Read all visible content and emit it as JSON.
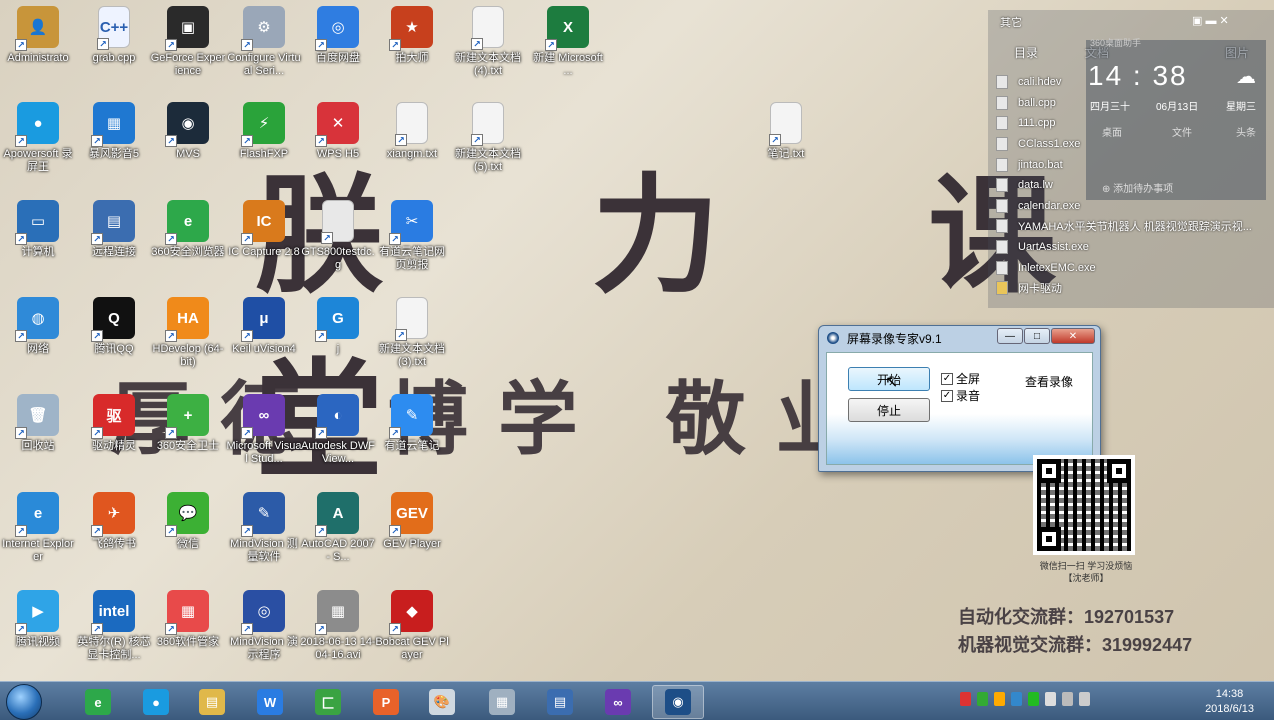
{
  "wallpaper": {
    "title": "朕 力 课 堂",
    "slogan": "厚德 博学 敬业 群",
    "group1": "自动化交流群：192701537",
    "group2": "机器视觉交流群：319992447",
    "qr_caption": "微信扫一扫 学习没烦恼\n【沈老师】"
  },
  "desktop": {
    "icons": [
      {
        "label": "Administrato",
        "color": "#c8953a",
        "glyph": "👤"
      },
      {
        "label": "grab.cpp",
        "color": "#eef3ff",
        "glyph": "C++"
      },
      {
        "label": "GeForce Experience",
        "color": "#2a2a2a",
        "glyph": "▣"
      },
      {
        "label": "Configure Virtual Seri...",
        "color": "#9aa7b8",
        "glyph": "⚙"
      },
      {
        "label": "百度网盘",
        "color": "#2f7de1",
        "glyph": "◎"
      },
      {
        "label": "拍大师",
        "color": "#c7401d",
        "glyph": "★"
      },
      {
        "label": "新建文本文档 (4).txt",
        "color": "#f4f4f4",
        "glyph": ""
      },
      {
        "label": "新建 Microsoft ...",
        "color": "#1d7c3f",
        "glyph": "X"
      },
      {
        "label": "Apowersoft 录屏王",
        "color": "#1a9be0",
        "glyph": "●"
      },
      {
        "label": "暴风影音5",
        "color": "#1f78d1",
        "glyph": "▦"
      },
      {
        "label": "MVS",
        "color": "#1c2b3a",
        "glyph": "◉"
      },
      {
        "label": "FlashFXP",
        "color": "#2aa33a",
        "glyph": "⚡"
      },
      {
        "label": "WPS H5",
        "color": "#d8333a",
        "glyph": "✕"
      },
      {
        "label": "xiangm.txt",
        "color": "#f4f4f4",
        "glyph": ""
      },
      {
        "label": "新建文本文档 (5).txt",
        "color": "#f4f4f4",
        "glyph": ""
      },
      {
        "label": "笔记.txt",
        "color": "#f4f4f4",
        "glyph": ""
      },
      {
        "label": "计算机",
        "color": "#2a6fb8",
        "glyph": "▭"
      },
      {
        "label": "远程连接",
        "color": "#3b6db0",
        "glyph": "▤"
      },
      {
        "label": "360安全浏览器",
        "color": "#2da84a",
        "glyph": "e"
      },
      {
        "label": "IC Capture 2.8",
        "color": "#d97a1c",
        "glyph": "IC"
      },
      {
        "label": "GTS800testdc.g",
        "color": "#e8e8e8",
        "glyph": ""
      },
      {
        "label": "有道云笔记网页剪报",
        "color": "#2a7ce2",
        "glyph": "✂"
      },
      {
        "label": "网络",
        "color": "#2f8ad8",
        "glyph": "◍"
      },
      {
        "label": "腾讯QQ",
        "color": "#111111",
        "glyph": "Q"
      },
      {
        "label": "HDevelop (64-bit)",
        "color": "#f08a1a",
        "glyph": "HA"
      },
      {
        "label": "Keil uVision4",
        "color": "#1f4fa5",
        "glyph": "μ"
      },
      {
        "label": "j",
        "color": "#1d86d8",
        "glyph": "G"
      },
      {
        "label": "新建文本文档 (3).txt",
        "color": "#f4f4f4",
        "glyph": ""
      },
      {
        "label": "回收站",
        "color": "#9fb4c8",
        "glyph": "🗑"
      },
      {
        "label": "驱动精灵",
        "color": "#d82a2a",
        "glyph": "驱"
      },
      {
        "label": "360安全卫士",
        "color": "#3db043",
        "glyph": "+"
      },
      {
        "label": "Microsoft Visual Stud...",
        "color": "#6a3bb0",
        "glyph": "∞"
      },
      {
        "label": "Autodesk DWF View...",
        "color": "#2b66c1",
        "glyph": "◐"
      },
      {
        "label": "有道云笔记",
        "color": "#2d8cf0",
        "glyph": "✎"
      },
      {
        "label": "Internet Explorer",
        "color": "#2a8ad8",
        "glyph": "e"
      },
      {
        "label": "飞鸽传书",
        "color": "#e0561f",
        "glyph": "✈"
      },
      {
        "label": "微信",
        "color": "#3cb034",
        "glyph": "💬"
      },
      {
        "label": "MindVision 测量软件",
        "color": "#2c5ba8",
        "glyph": "✎"
      },
      {
        "label": "AutoCAD 2007 - S...",
        "color": "#1f6f6a",
        "glyph": "A"
      },
      {
        "label": "GEV Player",
        "color": "#e26d1a",
        "glyph": "GEV"
      },
      {
        "label": "腾讯视频",
        "color": "#2fa4e7",
        "glyph": "▶"
      },
      {
        "label": "英特尔(R) 核芯显卡控制...",
        "color": "#1b6ac0",
        "glyph": "intel"
      },
      {
        "label": "360软件管家",
        "color": "#e84a4a",
        "glyph": "▦"
      },
      {
        "label": "MindVision 演示程序",
        "color": "#2a4fa3",
        "glyph": "◎"
      },
      {
        "label": "2018-06-13 14-04-16.avi",
        "color": "#8c8c8c",
        "glyph": "▦"
      },
      {
        "label": "Bobcat GEV Player",
        "color": "#c81e1e",
        "glyph": "◆"
      }
    ]
  },
  "sidebar": {
    "header": "其它",
    "tabs": [
      "目录",
      "文档",
      "图片"
    ],
    "clock_time": "14 : 38",
    "weekday": "四月三十",
    "date": "06月13日",
    "day": "星期三",
    "label_top": "360桌面助手",
    "btn_desktop": "桌面",
    "btn_file": "文件",
    "btn_more": "头条",
    "add_todo": "添加待办事项",
    "files": [
      "cali.hdev",
      "ball.cpp",
      "111.cpp",
      "CClass1.exe",
      "jintao.bat",
      "data.lw",
      "calendar.exe",
      "YAMAHA水平关节机器人 机器视觉跟踪演示视...",
      "UartAssist.exe",
      "InletexEMC.exe",
      "网卡驱动"
    ]
  },
  "dialog": {
    "title": "屏幕录像专家v9.1",
    "start": "开始",
    "stop": "停止",
    "fullscreen": "全屏",
    "audio": "录音",
    "view_recordings": "查看录像",
    "minimize": "—",
    "maximize": "□",
    "close": "✕"
  },
  "taskbar": {
    "time": "14:38",
    "date": "2018/6/13",
    "apps": [
      {
        "name": "360-browser",
        "color": "#2da84a",
        "glyph": "e"
      },
      {
        "name": "apowersoft",
        "color": "#1a9be0",
        "glyph": "●"
      },
      {
        "name": "explorer",
        "color": "#e0b84a",
        "glyph": "▤"
      },
      {
        "name": "wps-writer",
        "color": "#2a7ce2",
        "glyph": "W"
      },
      {
        "name": "green-app",
        "color": "#3aa342",
        "glyph": "匚"
      },
      {
        "name": "wps-ppt",
        "color": "#e8622a",
        "glyph": "P"
      },
      {
        "name": "paint",
        "color": "#cfd8e0",
        "glyph": "🎨"
      },
      {
        "name": "calculator",
        "color": "#9fb0c0",
        "glyph": "▦"
      },
      {
        "name": "remote",
        "color": "#3b6db0",
        "glyph": "▤"
      },
      {
        "name": "vs",
        "color": "#6a3bb0",
        "glyph": "∞"
      },
      {
        "name": "recorder",
        "color": "#1d4e87",
        "glyph": "◉"
      }
    ]
  }
}
